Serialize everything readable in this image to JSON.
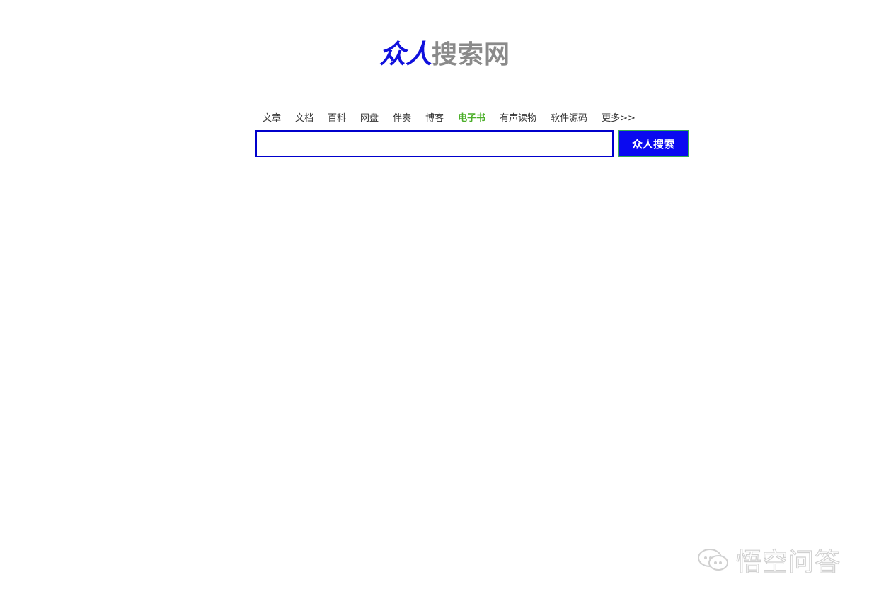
{
  "logo": {
    "primary": "众人",
    "secondary": "搜索网",
    "primary_color": "#1010dd",
    "secondary_color": "#8a8a8a"
  },
  "nav": {
    "items": [
      {
        "label": "文章",
        "active": false
      },
      {
        "label": "文档",
        "active": false
      },
      {
        "label": "百科",
        "active": false
      },
      {
        "label": "网盘",
        "active": false
      },
      {
        "label": "伴奏",
        "active": false
      },
      {
        "label": "博客",
        "active": false
      },
      {
        "label": "电子书",
        "active": true
      },
      {
        "label": "有声读物",
        "active": false
      },
      {
        "label": "软件源码",
        "active": false
      },
      {
        "label": "更多>>",
        "active": false
      }
    ],
    "active_color": "#4caf2a"
  },
  "search": {
    "value": "",
    "placeholder": "",
    "button_label": "众人搜索",
    "border_color": "#0000cc",
    "button_color": "#0a0af0"
  },
  "watermark": {
    "text": "悟空问答",
    "icon": "chat-bubbles-icon"
  }
}
